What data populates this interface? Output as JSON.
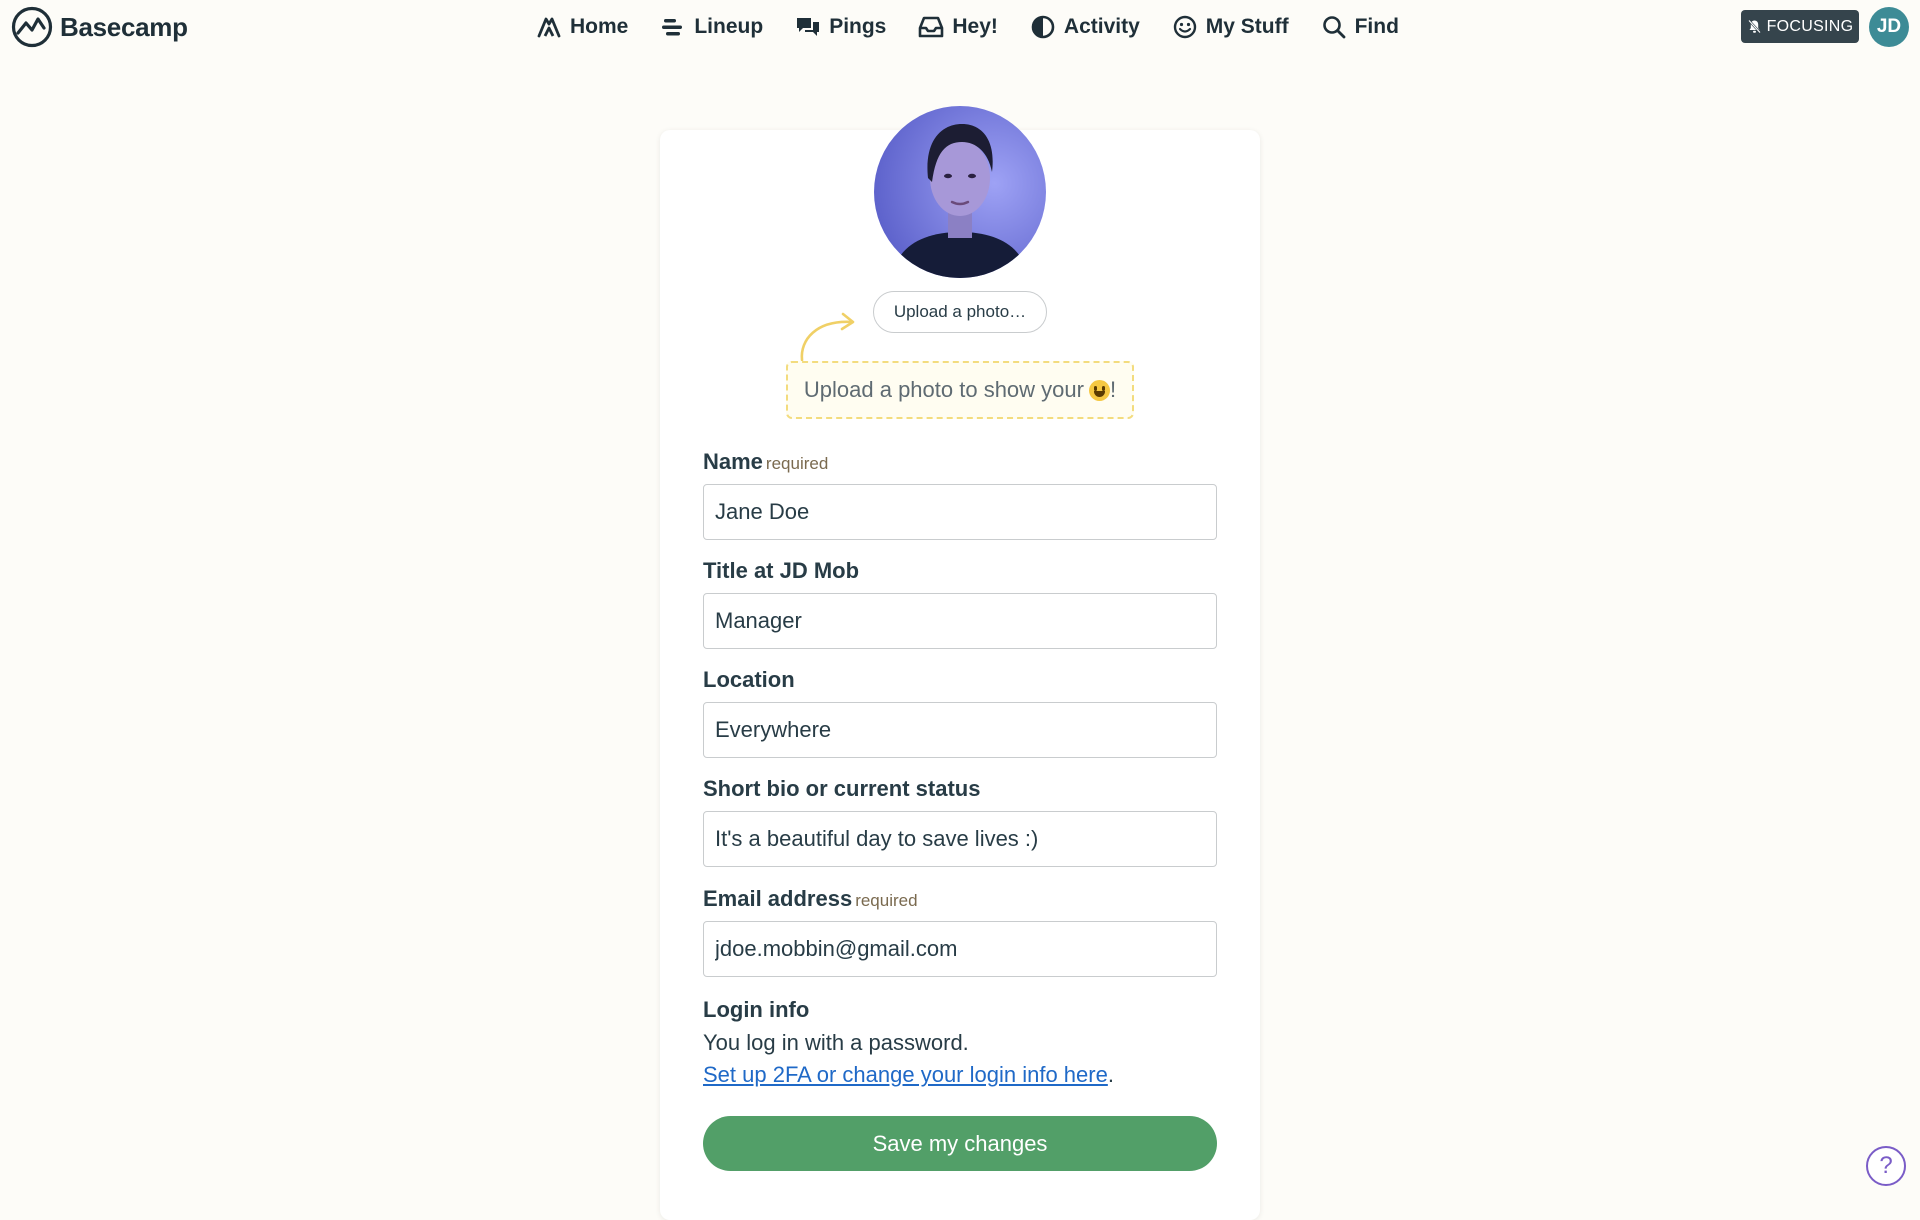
{
  "header": {
    "brand": "Basecamp",
    "nav": [
      {
        "label": "Home",
        "icon": "home-icon"
      },
      {
        "label": "Lineup",
        "icon": "lineup-icon"
      },
      {
        "label": "Pings",
        "icon": "pings-icon"
      },
      {
        "label": "Hey!",
        "icon": "inbox-icon"
      },
      {
        "label": "Activity",
        "icon": "activity-icon"
      },
      {
        "label": "My Stuff",
        "icon": "smiley-icon"
      },
      {
        "label": "Find",
        "icon": "search-icon"
      }
    ],
    "focus_badge": "FOCUSING",
    "user_initials": "JD",
    "user_avatar_color": "#3d8b96"
  },
  "profile": {
    "upload_button": "Upload a photo…",
    "hint_text": "Upload a photo to show your ",
    "hint_suffix": "!",
    "hint_emoji": "grinning-face-emoji"
  },
  "form": {
    "name": {
      "label": "Name",
      "required": "required",
      "value": "Jane Doe"
    },
    "title": {
      "label": "Title at JD Mob",
      "value": "Manager"
    },
    "location": {
      "label": "Location",
      "value": "Everywhere"
    },
    "bio": {
      "label": "Short bio or current status",
      "value": "It's a beautiful day to save lives :)"
    },
    "email": {
      "label": "Email address",
      "required": "required",
      "value": "jdoe.mobbin@gmail.com"
    },
    "login": {
      "title": "Login info",
      "text": "You log in with a password.",
      "link": "Set up 2FA or change your login info here",
      "link_suffix": "."
    },
    "save_button": "Save my changes"
  },
  "help": {
    "label": "?"
  },
  "colors": {
    "background": "#fdfcf8",
    "save_button": "#529f68",
    "link": "#1f69c7",
    "focus_badge": "#35444c",
    "hint_border": "#f3dc7e",
    "help_ring": "#7a5cc7"
  }
}
